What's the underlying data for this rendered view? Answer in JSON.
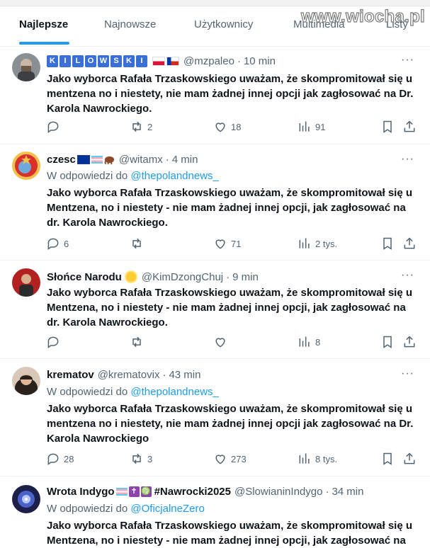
{
  "watermark": "www.wiocha.pl",
  "tabs": [
    {
      "label": "Najlepsze",
      "active": true
    },
    {
      "label": "Najnowsze",
      "active": false
    },
    {
      "label": "Użytkownicy",
      "active": false
    },
    {
      "label": "Multimedia",
      "active": false
    },
    {
      "label": "Listy",
      "active": false
    }
  ],
  "colors": {
    "accent": "#1d9bf0",
    "text": "#0f1419",
    "muted": "#536471"
  },
  "tweets": [
    {
      "name": "",
      "name_letters": [
        "K",
        "I",
        "L",
        "O",
        "W",
        "S",
        "K",
        "I"
      ],
      "handle": "@mzpaleo",
      "time": "10 min",
      "reply_prefix": "",
      "reply_to": "",
      "text": "Jako wyborca Rafała Trzaskowskiego uważam, że skompromitował się u mentzena no i niestety, nie mam żadnej innej opcji jak zagłosować na Dr. Karola Nawrockiego.",
      "replies": "",
      "reposts": "2",
      "likes": "18",
      "views": "91"
    },
    {
      "name": "czesc",
      "handle": "@witamx",
      "time": "4 min",
      "reply_prefix": "W odpowiedzi do",
      "reply_to": "@thepolandnews_",
      "text": "Jako wyborca Rafała Trzaskowskiego uważam, że skompromitował się u Mentzena, no i niestety - nie mam żadnej innej opcji, jak zagłosować na dr. Karola Nawrockiego.",
      "replies": "6",
      "reposts": "",
      "likes": "71",
      "views": "2 tys."
    },
    {
      "name": "Słońce Narodu",
      "handle": "@KimDzongChuj",
      "time": "9 min",
      "reply_prefix": "",
      "reply_to": "",
      "text": "Jako wyborca Rafała Trzaskowskiego uważam, że skompromitował się u Mentzena, no i niestety - nie mam żadnej innej opcji, jak zagłosować na dr. Karola Nawrockiego.",
      "replies": "",
      "reposts": "",
      "likes": "",
      "views": "8"
    },
    {
      "name": "krematov",
      "handle": "@krematovix",
      "time": "43 min",
      "reply_prefix": "W odpowiedzi do",
      "reply_to": "@thepolandnews_",
      "text": "Jako wyborca Rafała Trzaskowskiego uważam, że skompromitował się u mentzena no i niestety, nie mam żadnej innej opcji jak zagłosować na Dr. Karola Nawrockiego",
      "replies": "28",
      "reposts": "3",
      "likes": "273",
      "views": "8 tys."
    },
    {
      "name": "Wrota Indygo",
      "name_suffix": "#Nawrocki2025",
      "handle": "@SlowianinIndygo",
      "time": "34 min",
      "reply_prefix": "W odpowiedzi do",
      "reply_to": "@OficjalneZero",
      "text": "Jako wyborca Rafała Trzaskowskiego uważam, że skompromitował się u Mentzena, no i niestety - nie mam żadnej innej opcji, jak zagłosować na"
    }
  ],
  "more_label": "···",
  "dot": "·"
}
